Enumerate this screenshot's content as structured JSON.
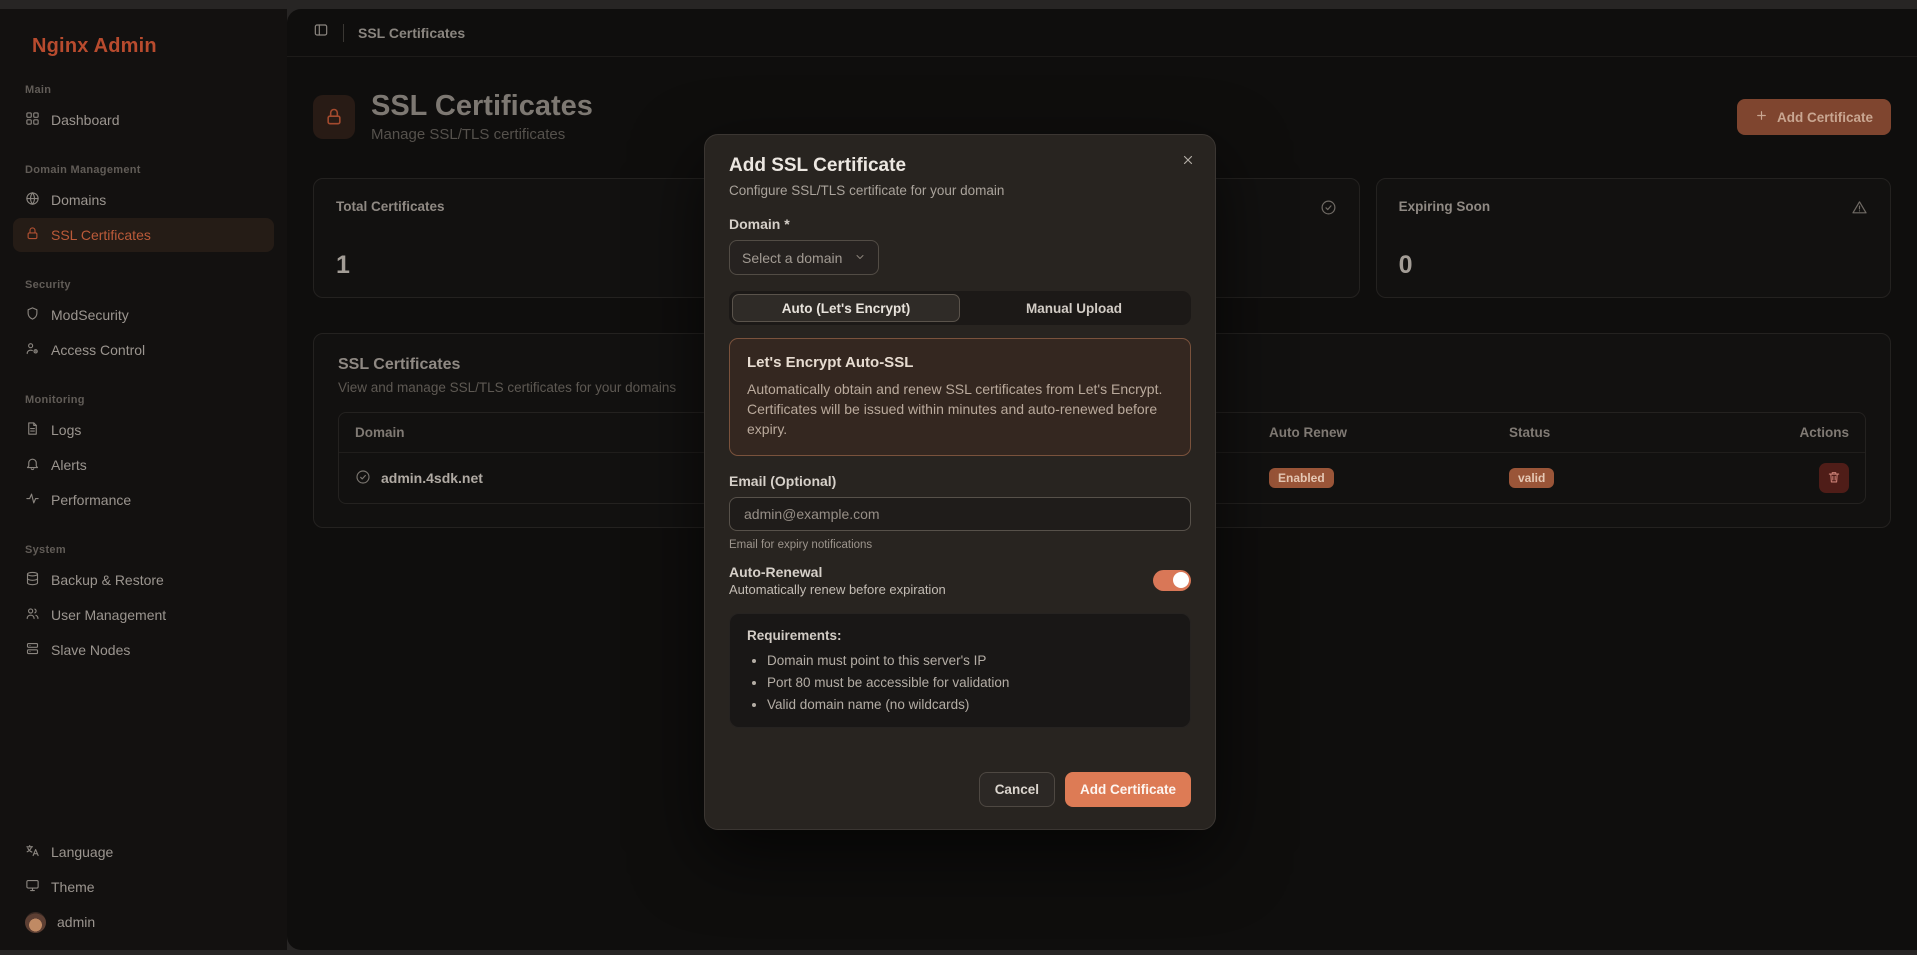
{
  "brand": "Nginx Admin",
  "colors": {
    "accent": "#d97757",
    "brand_orange": "#b84b2e",
    "badge_bg": "#9a5538",
    "danger_bg": "#4f1d18"
  },
  "sidebar": {
    "sections": [
      {
        "label": "Main",
        "items": [
          {
            "label": "Dashboard",
            "icon": "dashboard-grid-icon",
            "active": false
          }
        ]
      },
      {
        "label": "Domain Management",
        "items": [
          {
            "label": "Domains",
            "icon": "globe-icon",
            "active": false
          },
          {
            "label": "SSL Certificates",
            "icon": "lock-icon",
            "active": true
          }
        ]
      },
      {
        "label": "Security",
        "items": [
          {
            "label": "ModSecurity",
            "icon": "shield-icon",
            "active": false
          },
          {
            "label": "Access Control",
            "icon": "user-key-icon",
            "active": false
          }
        ]
      },
      {
        "label": "Monitoring",
        "items": [
          {
            "label": "Logs",
            "icon": "file-text-icon",
            "active": false
          },
          {
            "label": "Alerts",
            "icon": "bell-icon",
            "active": false
          },
          {
            "label": "Performance",
            "icon": "activity-icon",
            "active": false
          }
        ]
      },
      {
        "label": "System",
        "items": [
          {
            "label": "Backup & Restore",
            "icon": "database-icon",
            "active": false
          },
          {
            "label": "User Management",
            "icon": "users-icon",
            "active": false
          },
          {
            "label": "Slave Nodes",
            "icon": "server-icon",
            "active": false
          }
        ]
      }
    ],
    "footer": [
      {
        "label": "Language",
        "icon": "language-icon"
      },
      {
        "label": "Theme",
        "icon": "monitor-icon"
      },
      {
        "label": "admin",
        "icon": "avatar"
      }
    ]
  },
  "topbar": {
    "breadcrumb": "SSL Certificates"
  },
  "page": {
    "title": "SSL Certificates",
    "subtitle": "Manage SSL/TLS certificates",
    "add_certificate_label": "Add Certificate"
  },
  "stats": [
    {
      "label": "Total Certificates",
      "value": "1",
      "icon": ""
    },
    {
      "label": "",
      "value": "",
      "icon": "check-circle-icon"
    },
    {
      "label": "Expiring Soon",
      "value": "0",
      "icon": "warning-triangle-icon"
    }
  ],
  "table_card": {
    "title": "SSL Certificates",
    "subtitle": "View and manage SSL/TLS certificates for your domains",
    "columns": {
      "domain": "Domain",
      "auto_renew": "Auto Renew",
      "status": "Status",
      "actions": "Actions"
    },
    "rows": [
      {
        "domain": "admin.4sdk.net",
        "auto_renew": "Enabled",
        "status": "valid"
      }
    ]
  },
  "modal": {
    "title": "Add SSL Certificate",
    "subtitle": "Configure SSL/TLS certificate for your domain",
    "domain_label": "Domain *",
    "domain_placeholder": "Select a domain",
    "tabs": [
      {
        "label": "Auto (Let's Encrypt)",
        "active": true
      },
      {
        "label": "Manual Upload",
        "active": false
      }
    ],
    "info": {
      "title": "Let's Encrypt Auto-SSL",
      "body": "Automatically obtain and renew SSL certificates from Let's Encrypt. Certificates will be issued within minutes and auto-renewed before expiry."
    },
    "email_label": "Email (Optional)",
    "email_placeholder": "admin@example.com",
    "email_helper": "Email for expiry notifications",
    "auto_renewal": {
      "label": "Auto-Renewal",
      "description": "Automatically renew before expiration",
      "enabled": true
    },
    "requirements": {
      "title": "Requirements:",
      "items": [
        "Domain must point to this server's IP",
        "Port 80 must be accessible for validation",
        "Valid domain name (no wildcards)"
      ]
    },
    "cancel_label": "Cancel",
    "submit_label": "Add Certificate"
  }
}
